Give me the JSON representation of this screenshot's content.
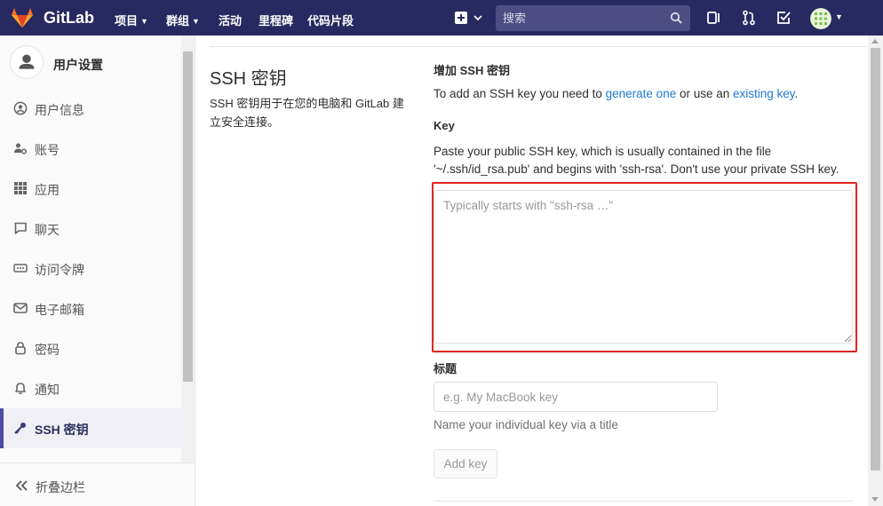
{
  "topbar": {
    "brand": "GitLab",
    "nav": [
      {
        "label": "项目",
        "dropdown": true
      },
      {
        "label": "群组",
        "dropdown": true
      },
      {
        "label": "活动",
        "dropdown": false
      },
      {
        "label": "里程碑",
        "dropdown": false
      },
      {
        "label": "代码片段",
        "dropdown": false
      }
    ],
    "search_placeholder": "搜索",
    "icons": [
      "plus-square-icon",
      "search-icon",
      "sidebar-toggle-icon",
      "merge-request-icon",
      "todo-check-icon",
      "user-avatar",
      "chevron-down-icon"
    ],
    "colors": {
      "background": "#292961",
      "search_bg": "#4d4d83"
    }
  },
  "sidebar": {
    "title": "用户设置",
    "items": [
      {
        "label": "用户信息",
        "icon": "user-circle-icon",
        "active": false
      },
      {
        "label": "账号",
        "icon": "account-gear-icon",
        "active": false
      },
      {
        "label": "应用",
        "icon": "grid-apps-icon",
        "active": false
      },
      {
        "label": "聊天",
        "icon": "comment-icon",
        "active": false
      },
      {
        "label": "访问令牌",
        "icon": "token-icon",
        "active": false
      },
      {
        "label": "电子邮箱",
        "icon": "mail-icon",
        "active": false
      },
      {
        "label": "密码",
        "icon": "lock-icon",
        "active": false
      },
      {
        "label": "通知",
        "icon": "bell-icon",
        "active": false
      },
      {
        "label": "SSH 密钥",
        "icon": "key-icon",
        "active": true
      }
    ],
    "collapse_label": "折叠边栏"
  },
  "main": {
    "section_title": "SSH 密钥",
    "section_desc": "SSH 密钥用于在您的电脑和 GitLab 建立安全连接。",
    "add_heading": "增加 SSH 密钥",
    "add_text_before": "To add an SSH key you need to ",
    "generate_link": "generate one",
    "add_text_middle": " or use an ",
    "existing_link": "existing key",
    "add_text_after": ".",
    "key_label": "Key",
    "key_help": "Paste your public SSH key, which is usually contained in the file '~/.ssh/id_rsa.pub' and begins with 'ssh-rsa'. Don't use your private SSH key.",
    "key_placeholder": "Typically starts with \"ssh-rsa …\"",
    "key_value": "",
    "title_label": "标题",
    "title_placeholder": "e.g. My MacBook key",
    "title_value": "",
    "title_help": "Name your individual key via a title",
    "add_button": "Add key",
    "colors": {
      "link": "#1f78d1",
      "highlight_frame": "#e0271c",
      "active_bar": "#4b4ba3"
    }
  }
}
